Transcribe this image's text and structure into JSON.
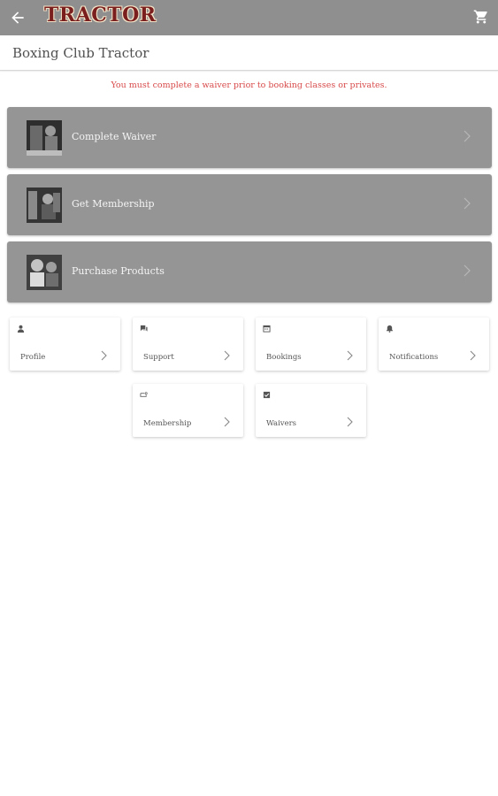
{
  "topbar": {
    "back_icon": "arrow-left-icon",
    "logo_text": "TRACTOR",
    "cart_icon": "shopping-cart-icon"
  },
  "page": {
    "title": "Boxing Club Tractor"
  },
  "warning": {
    "text": "You must complete a waiver prior to booking classes or privates."
  },
  "actions": [
    {
      "label": "Complete Waiver",
      "icon": "chevron-right-icon"
    },
    {
      "label": "Get Membership",
      "icon": "chevron-right-icon"
    },
    {
      "label": "Purchase Products",
      "icon": "chevron-right-icon"
    }
  ],
  "tiles": [
    {
      "label": "Profile",
      "icon": "person-icon"
    },
    {
      "label": "Support",
      "icon": "chat-icon"
    },
    {
      "label": "Bookings",
      "icon": "calendar-icon"
    },
    {
      "label": "Notifications",
      "icon": "bell-icon"
    },
    {
      "label": "Membership",
      "icon": "membership-card-icon"
    },
    {
      "label": "Waivers",
      "icon": "checkbox-icon"
    }
  ],
  "colors": {
    "topbar": "#8f8f8f",
    "action_card": "#959595",
    "warning": "#d84a4a",
    "logo": "#7a1e1e"
  }
}
